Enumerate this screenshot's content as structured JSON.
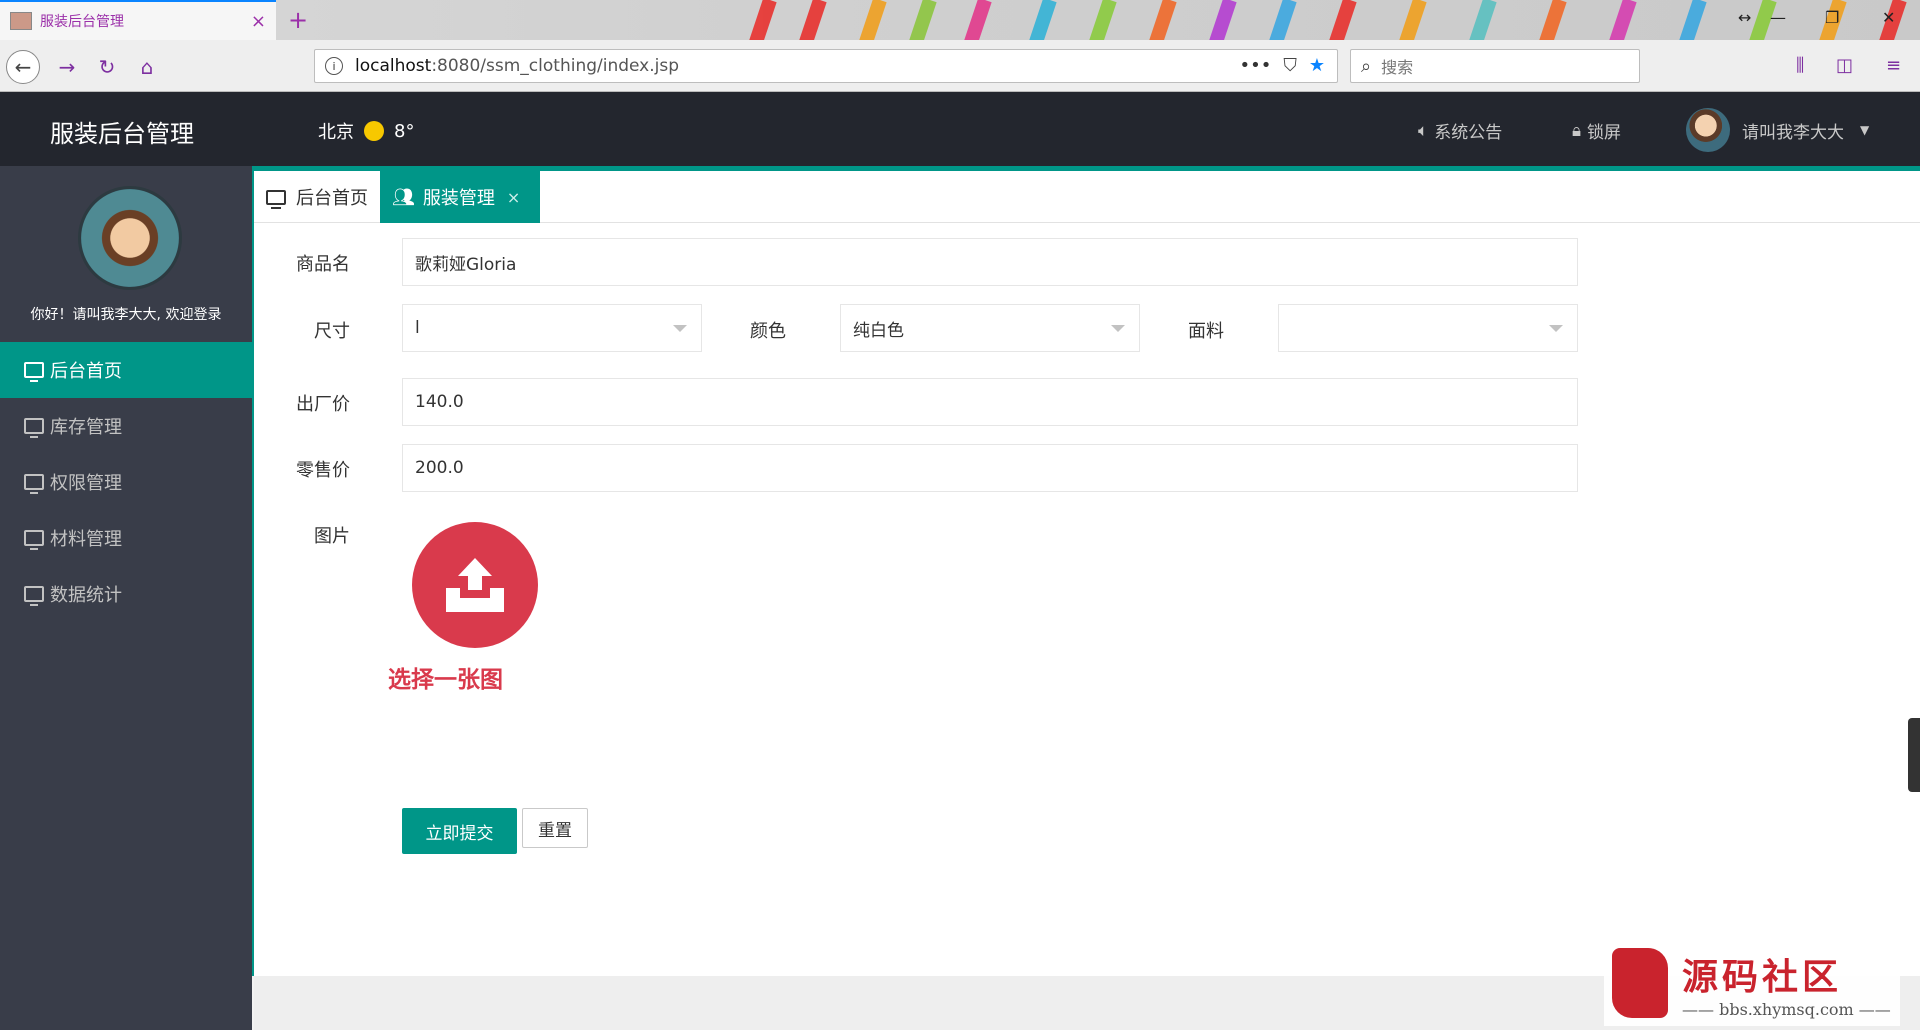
{
  "browser": {
    "tab_title": "服装后台管理",
    "tab_close": "×",
    "new_tab": "+",
    "url_host": "localhost",
    "url_path": ":8080/ssm_clothing/index.jsp",
    "search_placeholder": "搜索",
    "url_more": "•••"
  },
  "header": {
    "logo": "服装后台管理",
    "city": "北京",
    "temperature": "8°",
    "announcement": "系统公告",
    "lock": "锁屏",
    "username": "请叫我李大大"
  },
  "sidebar": {
    "greeting": "你好！请叫我李大大, 欢迎登录",
    "items": [
      {
        "label": "后台首页",
        "active": true
      },
      {
        "label": "库存管理",
        "active": false
      },
      {
        "label": "权限管理",
        "active": false
      },
      {
        "label": "材料管理",
        "active": false
      },
      {
        "label": "数据统计",
        "active": false
      }
    ]
  },
  "tabs": [
    {
      "label": "后台首页",
      "active": false
    },
    {
      "label": "服装管理",
      "active": true,
      "close": "×"
    }
  ],
  "form": {
    "name_label": "商品名",
    "name_value": "歌莉娅Gloria",
    "size_label": "尺寸",
    "size_value": "l",
    "color_label": "颜色",
    "color_value": "纯白色",
    "fabric_label": "面料",
    "fabric_value": "",
    "factory_price_label": "出厂价",
    "factory_price_value": "140.0",
    "retail_price_label": "零售价",
    "retail_price_value": "200.0",
    "image_label": "图片",
    "upload_label": "选择一张图",
    "submit_label": "立即提交",
    "reset_label": "重置"
  },
  "watermark": {
    "title": "源码社区",
    "url": "—— bbs.xhymsq.com ——"
  },
  "colors": {
    "accent": "#009688",
    "sidebar_bg": "#393d49",
    "header_bg": "#23262e",
    "upload_red": "#d93a4c"
  }
}
